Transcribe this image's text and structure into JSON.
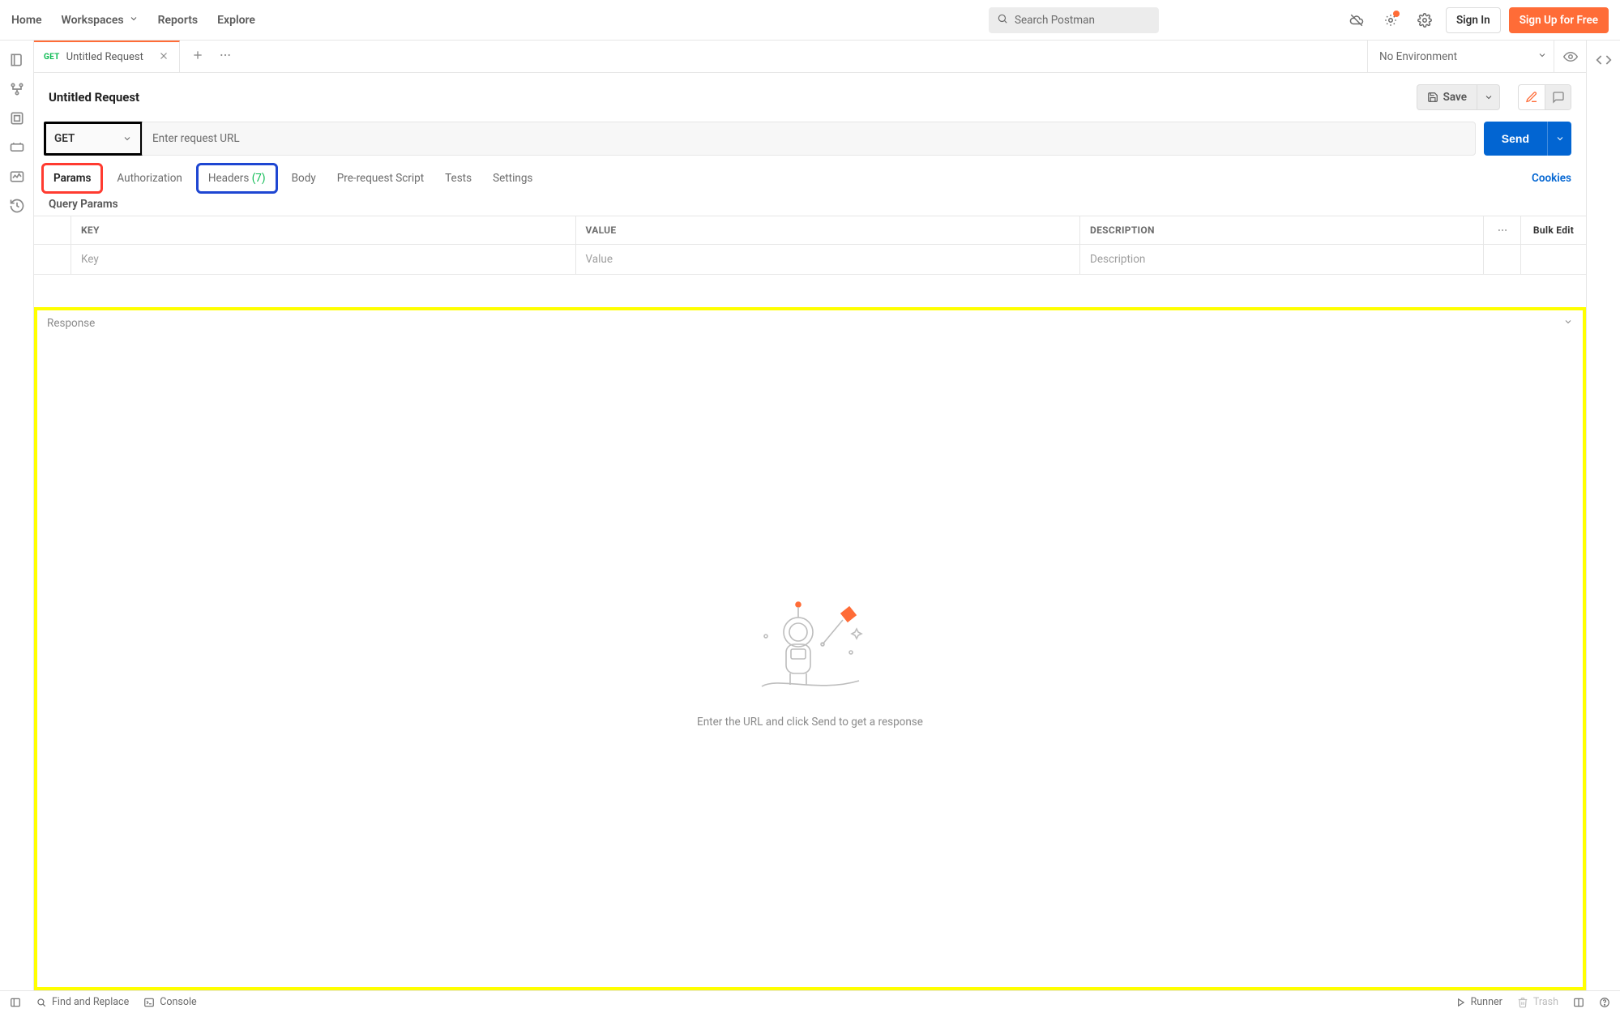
{
  "nav": {
    "home": "Home",
    "workspaces": "Workspaces",
    "reports": "Reports",
    "explore": "Explore",
    "search_placeholder": "Search Postman",
    "sign_in": "Sign In",
    "sign_up": "Sign Up for Free"
  },
  "tab": {
    "method": "GET",
    "title": "Untitled Request"
  },
  "env": {
    "selected": "No Environment"
  },
  "request": {
    "title": "Untitled Request",
    "save_label": "Save",
    "method": "GET",
    "url_placeholder": "Enter request URL",
    "send_label": "Send"
  },
  "subtabs": {
    "params": "Params",
    "authorization": "Authorization",
    "headers": "Headers",
    "headers_count": "(7)",
    "body": "Body",
    "prerequest": "Pre-request Script",
    "tests": "Tests",
    "settings": "Settings",
    "cookies": "Cookies"
  },
  "params": {
    "section": "Query Params",
    "cols": {
      "key": "KEY",
      "value": "VALUE",
      "description": "DESCRIPTION"
    },
    "placeholders": {
      "key": "Key",
      "value": "Value",
      "description": "Description"
    },
    "bulk_edit": "Bulk Edit"
  },
  "response": {
    "title": "Response",
    "empty_text": "Enter the URL and click Send to get a response"
  },
  "status": {
    "find_replace": "Find and Replace",
    "console": "Console",
    "runner": "Runner",
    "trash": "Trash"
  },
  "colors": {
    "accent_orange": "#ff6c37",
    "accent_blue": "#0265d2",
    "accent_green": "#0cbb52",
    "highlight_yellow": "#ffff00"
  },
  "highlights": {
    "method_box": "#000000",
    "params_tab": "#ff3b30",
    "headers_tab": "#1e46d2",
    "response_panel": "#ffff00"
  }
}
